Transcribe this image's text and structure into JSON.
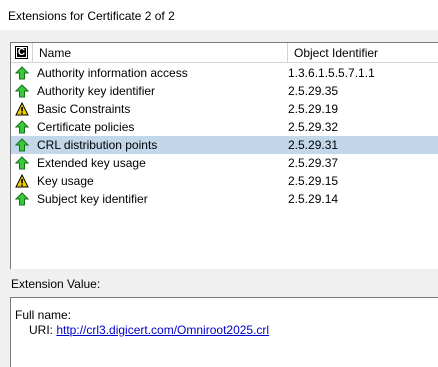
{
  "window": {
    "title": "Extensions for Certificate 2 of 2"
  },
  "table": {
    "columns": [
      "Name",
      "Object Identifier"
    ],
    "rows": [
      {
        "name": "Authority information access",
        "oid": "1.3.6.1.5.5.7.1.1",
        "icon": "green-up-arrow-icon",
        "selected": false
      },
      {
        "name": "Authority key identifier",
        "oid": "2.5.29.35",
        "icon": "green-up-arrow-icon",
        "selected": false
      },
      {
        "name": "Basic Constraints",
        "oid": "2.5.29.19",
        "icon": "warning-icon",
        "selected": false
      },
      {
        "name": "Certificate policies",
        "oid": "2.5.29.32",
        "icon": "green-up-arrow-icon",
        "selected": false
      },
      {
        "name": "CRL distribution points",
        "oid": "2.5.29.31",
        "icon": "green-up-arrow-icon",
        "selected": true
      },
      {
        "name": "Extended key usage",
        "oid": "2.5.29.37",
        "icon": "green-up-arrow-icon",
        "selected": false
      },
      {
        "name": "Key usage",
        "oid": "2.5.29.15",
        "icon": "warning-icon",
        "selected": false
      },
      {
        "name": "Subject key identifier",
        "oid": "2.5.29.14",
        "icon": "green-up-arrow-icon",
        "selected": false
      }
    ]
  },
  "extension_value": {
    "label": "Extension Value:",
    "full_name_label": "Full name:",
    "uri_prefix": "URI: ",
    "uri": "http://crl3.digicert.com/Omniroot2025.crl"
  },
  "colors": {
    "selected_row": "#c3d7ea",
    "link": "#0000cc",
    "arrow_green": "#3cc83c",
    "warning_yellow": "#f5d000"
  }
}
